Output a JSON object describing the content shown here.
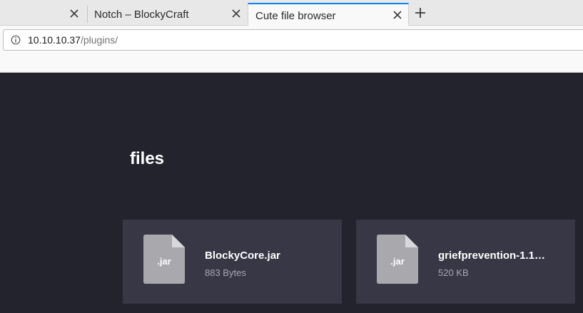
{
  "browser": {
    "tabs": [
      {
        "label": "",
        "active": false
      },
      {
        "label": "Notch – BlockyCraft",
        "active": false
      },
      {
        "label": "Cute file browser",
        "active": true
      }
    ],
    "url": {
      "host": "10.10.10.37",
      "path": "/plugins/"
    }
  },
  "page": {
    "heading": "files",
    "files": [
      {
        "ext": ".jar",
        "name": "BlockyCore.jar",
        "size": "883 Bytes"
      },
      {
        "ext": ".jar",
        "name": "griefprevention-1.1…",
        "size": "520 KB"
      }
    ]
  },
  "colors": {
    "tab_accent": "#0a84ff",
    "page_background": "#23232e",
    "card_background": "#373745",
    "file_icon": "#a9a9ad"
  },
  "icons": [
    "close-icon",
    "plus-icon",
    "info-icon",
    "file-icon"
  ]
}
